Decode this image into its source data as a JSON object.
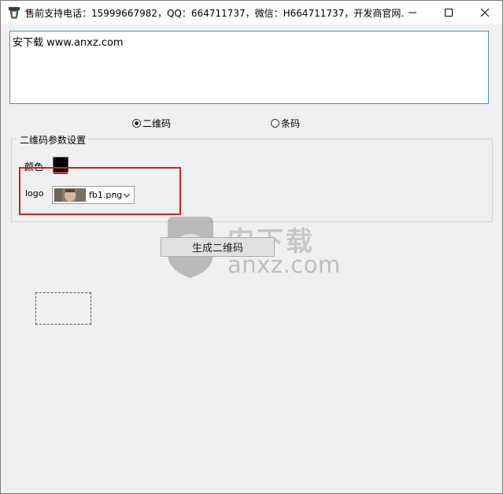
{
  "window": {
    "title": "售前支持电话：15999667982，QQ：664711737，微信：H664711737，开发商官网..."
  },
  "textbox": {
    "value": "安下载 www.anxz.com"
  },
  "mode": {
    "qr_label": "二维码",
    "barcode_label": "条码",
    "selected": "二维码"
  },
  "qr_settings": {
    "group_title": "二维码参数设置",
    "color_label": "颜色",
    "color_value": "#000000",
    "logo_label": "logo",
    "logo_file": "fb1.png"
  },
  "actions": {
    "generate_label": "生成二维码"
  },
  "watermark": {
    "cn": "安下载",
    "en": "anxz.com"
  },
  "icons": {
    "app": "app-icon",
    "minimize": "minimize-icon",
    "maximize": "maximize-icon",
    "close": "close-icon",
    "dropdown": "chevron-down-icon",
    "watermark": "shield-icon"
  },
  "colors": {
    "highlight": "#d21f1f",
    "textbox_border": "#4f8fb6"
  }
}
